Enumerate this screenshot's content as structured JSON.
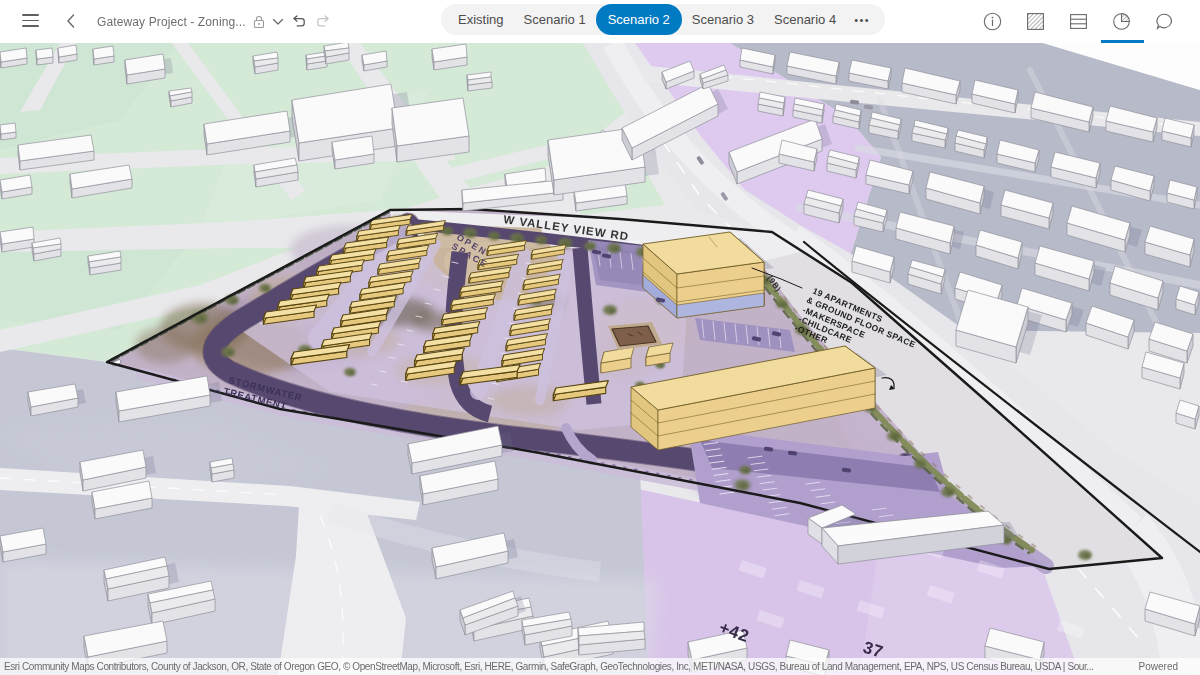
{
  "header": {
    "menu_icon": "hamburger-menu",
    "back_icon": "chevron-left",
    "title": "Gateway Project - Zoning...",
    "lock_icon": "lock",
    "title_dropdown_icon": "chevron-down",
    "undo_icon": "undo-arrow",
    "redo_icon": "redo-arrow",
    "tabs": [
      {
        "label": "Existing",
        "selected": false
      },
      {
        "label": "Scenario 1",
        "selected": false
      },
      {
        "label": "Scenario 2",
        "selected": true
      },
      {
        "label": "Scenario 3",
        "selected": false
      },
      {
        "label": "Scenario 4",
        "selected": false
      }
    ],
    "tabs_overflow_icon": "ellipsis",
    "tabs_overflow_label": "•••",
    "right_icons": [
      "info-circle",
      "zoning-hatch-square",
      "table-rows",
      "dashboard-pie-chart",
      "feedback-chat-bubble"
    ],
    "active_tool": "dashboard-pie-chart",
    "accent_color": "#007ac2"
  },
  "map": {
    "labels": {
      "road_valley_view": "W VALLEY VIEW RD",
      "open_space_line1": "OPEN",
      "open_space_line2": "SPACE",
      "stormwater_line1": "STORMWATER",
      "stormwater_line2": "TREATMENT",
      "program_line1": "19 APARTMENTS",
      "program_line2": "& GROUND FLOOR SPACE",
      "program_line3": "-MAKERSPACE",
      "program_line4": "-CHILDCARE",
      "program_line5": "-OTHER",
      "road_9b": "(9B)",
      "parcel_plus42": "+42",
      "parcel_37": "37"
    },
    "zone_colors": {
      "single_family_green": "#d5e9d7",
      "residential_bluegray": "#b7bac9",
      "commercial_lilac": "#ddcaee",
      "scenario_yellow": "#f2dc9d",
      "ground_floor_periwinkle": "#aeb6e0",
      "site_road_purple": "#57486f"
    }
  },
  "attribution": {
    "sources": "Esri Community Maps Contributors, County of Jackson, OR, State of Oregon GEO, © OpenStreetMap, Microsoft, Esri, HERE, Garmin, SafeGraph, GeoTechnologies, Inc, METI/NASA, USGS, Bureau of Land Management, EPA, NPS, US Census Bureau, USDA | Sour...",
    "powered": "Powered"
  }
}
